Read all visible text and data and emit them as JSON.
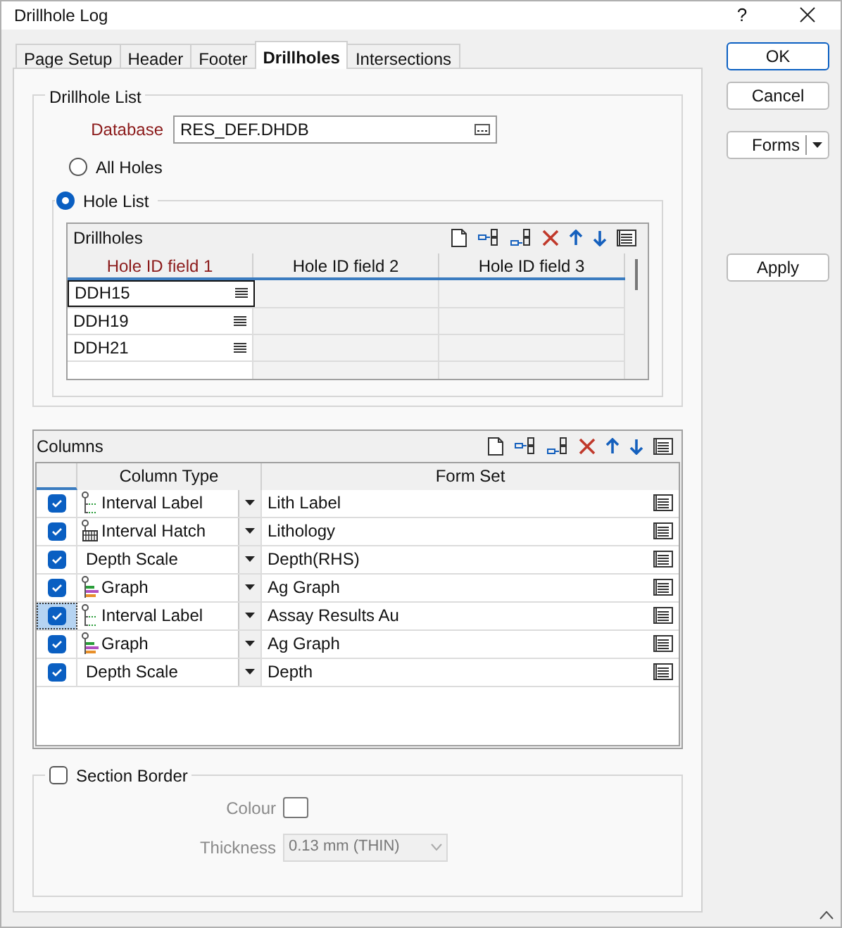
{
  "window": {
    "title": "Drillhole Log",
    "help": "?"
  },
  "tabs": [
    {
      "label": "Page Setup",
      "selected": false
    },
    {
      "label": "Header",
      "selected": false
    },
    {
      "label": "Footer",
      "selected": false
    },
    {
      "label": "Drillholes",
      "selected": true
    },
    {
      "label": "Intersections",
      "selected": false
    }
  ],
  "drillhole_list": {
    "title": "Drillhole List",
    "database_label": "Database",
    "database_value": "RES_DEF.DHDB",
    "options": [
      {
        "label": "All Holes",
        "selected": false
      },
      {
        "label": "Hole List",
        "selected": true
      }
    ],
    "grid": {
      "title": "Drillholes",
      "columns": [
        {
          "label": "Hole ID field 1",
          "required": true
        },
        {
          "label": "Hole ID field 2",
          "required": false
        },
        {
          "label": "Hole ID field 3",
          "required": false
        }
      ],
      "rows": [
        {
          "cells": [
            "DDH15",
            "",
            ""
          ],
          "selected": true
        },
        {
          "cells": [
            "DDH19",
            "",
            ""
          ],
          "selected": false
        },
        {
          "cells": [
            "DDH21",
            "",
            ""
          ],
          "selected": false
        }
      ]
    }
  },
  "columns": {
    "title": "Columns",
    "headers": [
      "Column Type",
      "Form Set"
    ],
    "rows": [
      {
        "checked": true,
        "kind": "label",
        "type": "Interval Label",
        "form_set": "Lith Label",
        "selected": false
      },
      {
        "checked": true,
        "kind": "hatch",
        "type": "Interval Hatch",
        "form_set": "Lithology",
        "selected": false
      },
      {
        "checked": true,
        "kind": "plain",
        "type": "Depth Scale",
        "form_set": "Depth(RHS)",
        "selected": false
      },
      {
        "checked": true,
        "kind": "graph",
        "type": "Graph",
        "form_set": "Ag Graph",
        "selected": false
      },
      {
        "checked": true,
        "kind": "label",
        "type": "Interval Label",
        "form_set": "Assay Results Au",
        "selected": true
      },
      {
        "checked": true,
        "kind": "graph",
        "type": "Graph",
        "form_set": "Ag Graph",
        "selected": false
      },
      {
        "checked": true,
        "kind": "plain",
        "type": "Depth Scale",
        "form_set": "Depth",
        "selected": false
      }
    ]
  },
  "section_border": {
    "label": "Section Border",
    "checked": false,
    "colour_label": "Colour",
    "thickness_label": "Thickness",
    "thickness_value": "0.13 mm (THIN)",
    "disabled": true
  },
  "buttons": {
    "ok": "OK",
    "cancel": "Cancel",
    "forms": "Forms",
    "apply": "Apply"
  }
}
